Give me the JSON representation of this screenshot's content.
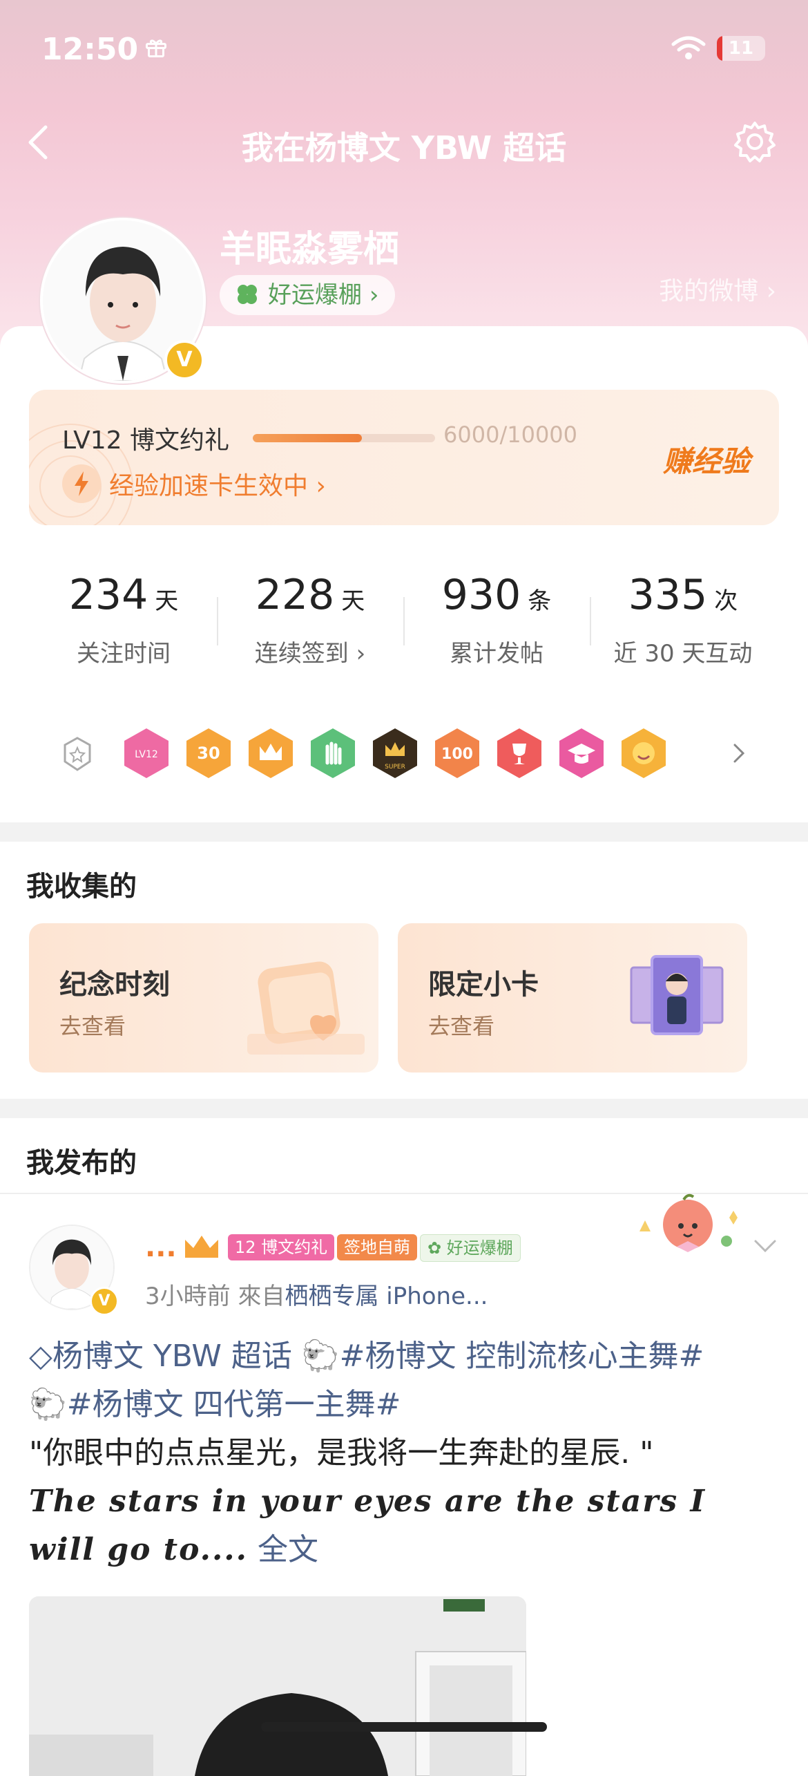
{
  "status_bar": {
    "time": "12:50",
    "battery": "11",
    "battery_level_percent": 11
  },
  "header": {
    "title": "我在杨博文 YBW 超话"
  },
  "profile": {
    "username": "羊眠淼雾栖",
    "luck_badge": "好运爆棚",
    "my_weibo": "我的微博"
  },
  "level": {
    "name": "LV12 博文约礼",
    "exp_text": "6000/10000",
    "progress_fraction": 0.6,
    "boost_text": "经验加速卡生效中",
    "earn_button": "赚经验"
  },
  "stats": [
    {
      "value": "234",
      "unit": "天",
      "label": "关注时间"
    },
    {
      "value": "228",
      "unit": "天",
      "label": "连续签到"
    },
    {
      "value": "930",
      "unit": "条",
      "label": "累计发帖"
    },
    {
      "value": "335",
      "unit": "次",
      "label": "近 30 天互动"
    }
  ],
  "badges": [
    "lv12-badge",
    "30-days-badge",
    "crown-badge",
    "hand-badge",
    "super-badge",
    "100-days-badge",
    "trophy-badge",
    "graduate-badge",
    "emoji-badge"
  ],
  "collect": {
    "title": "我收集的",
    "cards": [
      {
        "name": "纪念时刻",
        "sub": "去查看"
      },
      {
        "name": "限定小卡",
        "sub": "去查看"
      }
    ]
  },
  "posted": {
    "title": "我发布的",
    "post": {
      "author": "...",
      "tags": [
        "博文约礼",
        "签地自萌",
        "好运爆棚"
      ],
      "level_tag": "12",
      "time": "3小時前",
      "source_prefix": "來自",
      "source": "栖栖专属 iPhone...",
      "topic_main": "杨博文 YBW 超话",
      "topic_1": "#杨博文 控制流核心主舞#",
      "topic_2": "#杨博文 四代第一主舞#",
      "quote": "\"你眼中的点点星光，是我将一生奔赴的星辰. \"",
      "english": "The stars in your eyes are the stars I will go to....",
      "full_text": "全文"
    }
  },
  "colors": {
    "accent": "#f07d2f",
    "topic": "#4c6189",
    "verified": "#f3b924"
  }
}
